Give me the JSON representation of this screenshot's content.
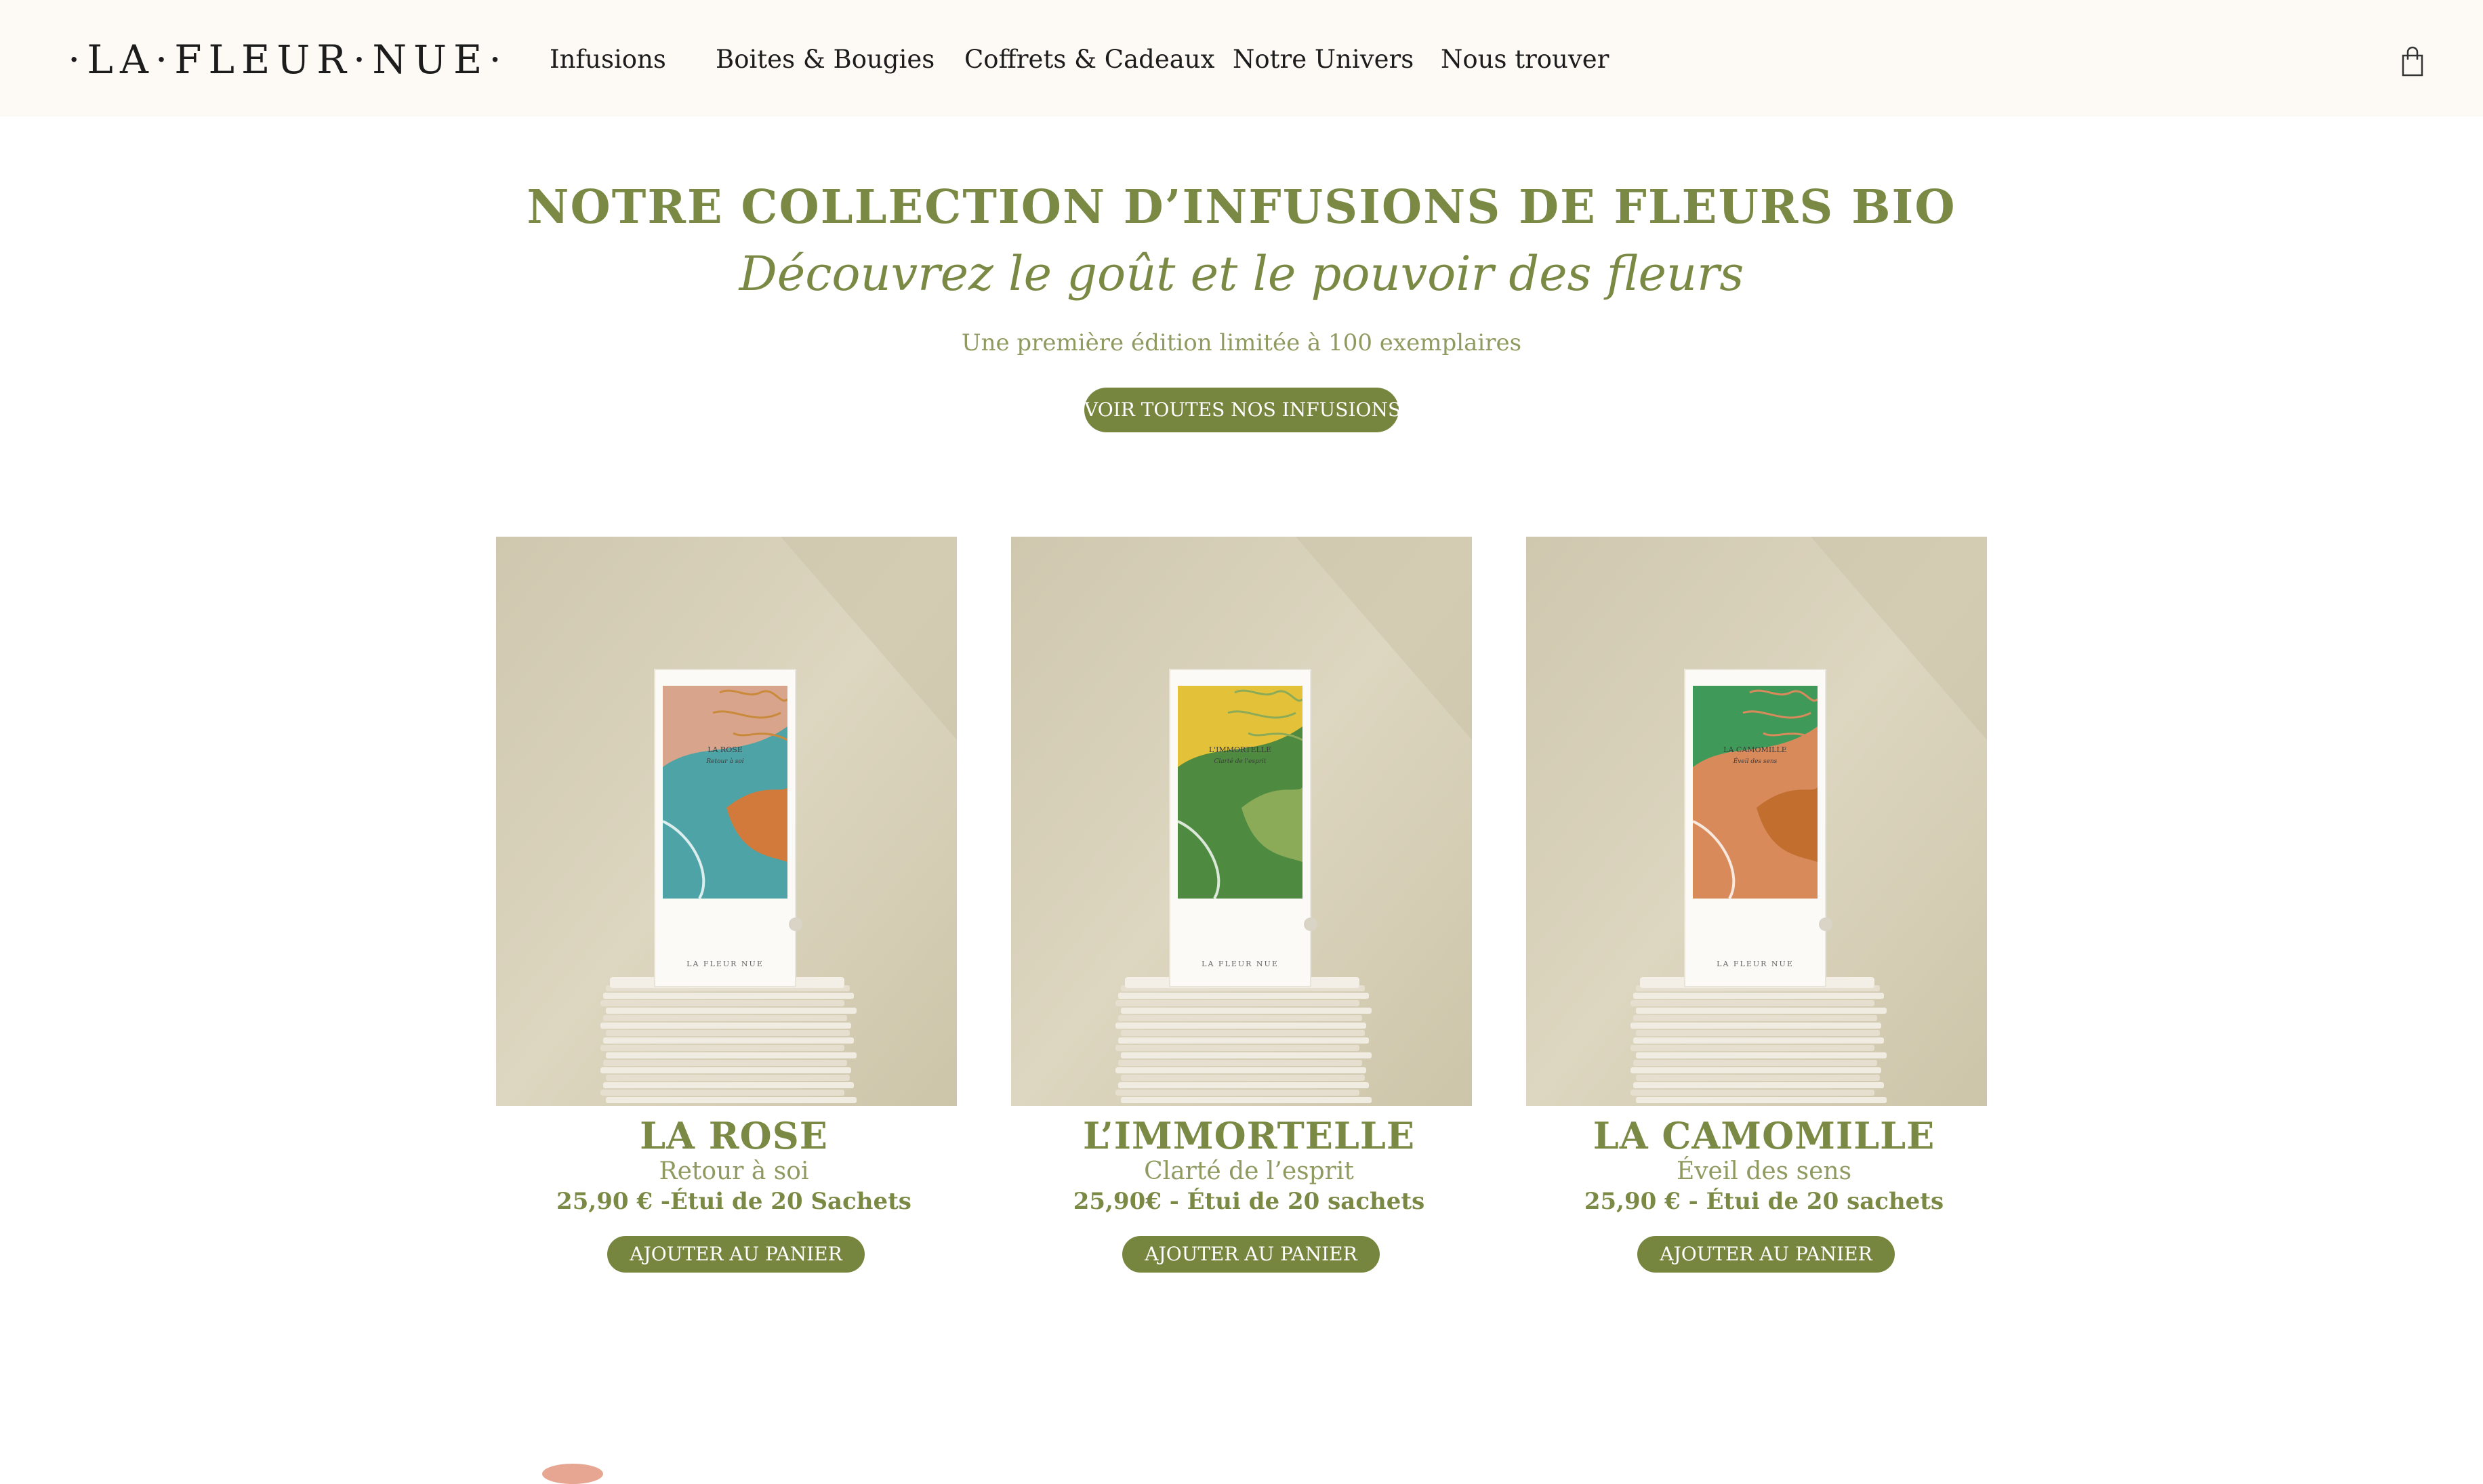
{
  "header": {
    "logo": "·LA·FLEUR·NUE·",
    "nav": [
      {
        "label": "Infusions"
      },
      {
        "label": "Boites & Bougies"
      },
      {
        "label": "Coffrets & Cadeaux"
      },
      {
        "label": "Notre Univers"
      },
      {
        "label": "Nous trouver"
      }
    ],
    "cart_icon": "shopping-bag-icon"
  },
  "hero": {
    "title": "NOTRE COLLECTION D’INFUSIONS DE FLEURS BIO",
    "subtitle": "Découvrez le goût et le pouvoir des fleurs",
    "note": "Une première édition limitée à 100 exemplaires",
    "cta": "VOIR TOUTES NOS INFUSIONS"
  },
  "products": [
    {
      "name": "LA ROSE",
      "tagline": "Retour à soi",
      "price": "25,90 € -Étui de 20 Sachets",
      "button": "AJOUTER AU PANIER",
      "pack_title": "LA ROSE",
      "pack_sub": "Retour à soi",
      "pack_brand": "LA FLEUR NUE",
      "colors": {
        "a": "#d9a48c",
        "b": "#4da3a6",
        "c": "#d27a3c",
        "line": "#c98a3c"
      }
    },
    {
      "name": "L’IMMORTELLE",
      "tagline": "Clarté de l’esprit",
      "price": "25,90€ - Étui de 20 sachets",
      "button": "AJOUTER AU PANIER",
      "pack_title": "L'IMMORTELLE",
      "pack_sub": "Clarté de l'esprit",
      "pack_brand": "LA FLEUR NUE",
      "colors": {
        "a": "#e3c23a",
        "b": "#4e8a40",
        "c": "#8cab58",
        "line": "#8cab58"
      }
    },
    {
      "name": "LA CAMOMILLE",
      "tagline": "Éveil des sens",
      "price": "25,90 € - Étui de 20 sachets",
      "button": "AJOUTER AU PANIER",
      "pack_title": "LA CAMOMILLE",
      "pack_sub": "Éveil des sens",
      "pack_brand": "LA FLEUR NUE",
      "colors": {
        "a": "#3f9a5a",
        "b": "#d98a5a",
        "c": "#c26e2e",
        "line": "#d98a5a"
      }
    }
  ]
}
